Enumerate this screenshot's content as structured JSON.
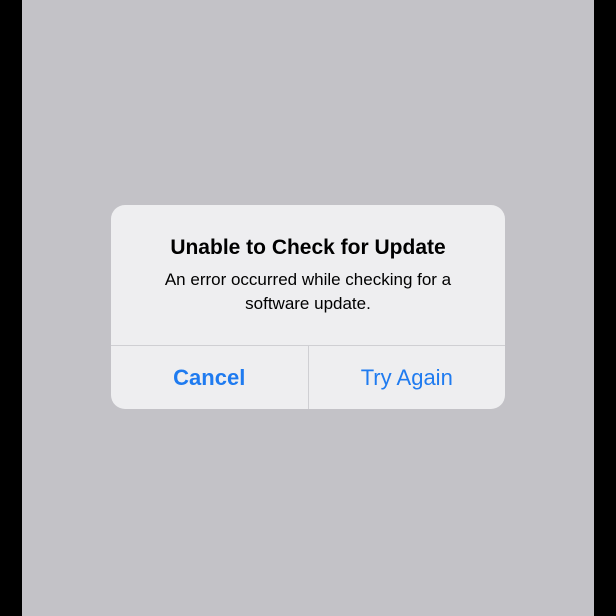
{
  "alert": {
    "title": "Unable to Check for Update",
    "message": "An error occurred while checking for a software update.",
    "cancel_label": "Cancel",
    "retry_label": "Try Again"
  },
  "colors": {
    "screen_background": "#c3c2c7",
    "alert_background": "#eeeef0",
    "button_text": "#1f7bf0",
    "device_frame": "#000000"
  }
}
